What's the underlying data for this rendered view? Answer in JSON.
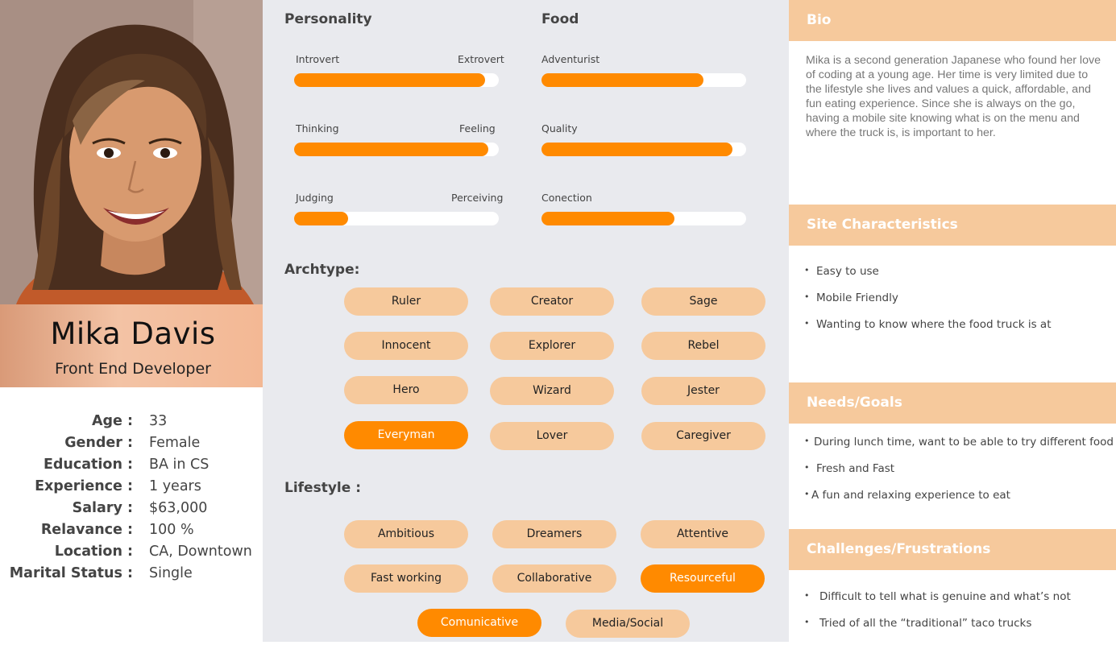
{
  "persona": {
    "name": "Mika Davis",
    "role": "Front End Developer",
    "facts": [
      {
        "key": "Age :",
        "value": "33"
      },
      {
        "key": "Gender :",
        "value": "Female"
      },
      {
        "key": "Education :",
        "value": "BA in CS"
      },
      {
        "key": "Experience :",
        "value": "1 years"
      },
      {
        "key": "Salary :",
        "value": "$63,000"
      },
      {
        "key": "Relavance :",
        "value": "100 %"
      },
      {
        "key": "Location :",
        "value": "CA, Downtown"
      },
      {
        "key": "Marital Status :",
        "value": "Single"
      }
    ]
  },
  "personality": {
    "title": "Personality",
    "scales": [
      {
        "left": "Introvert",
        "right": "Extrovert",
        "value": 0.935
      },
      {
        "left": "Thinking",
        "right": "Feeling",
        "value": 0.95
      },
      {
        "left": "Judging",
        "right": "Perceiving",
        "value": 0.265
      }
    ]
  },
  "food": {
    "title": "Food",
    "scales": [
      {
        "label": "Adventurist",
        "value": 0.79
      },
      {
        "label": "Quality",
        "value": 0.935
      },
      {
        "label": "Conection",
        "value": 0.65
      }
    ]
  },
  "archetype": {
    "title": "Archtype:",
    "items": [
      {
        "label": "Ruler",
        "active": false
      },
      {
        "label": "Creator",
        "active": false
      },
      {
        "label": "Sage",
        "active": false
      },
      {
        "label": "Innocent",
        "active": false
      },
      {
        "label": "Explorer",
        "active": false
      },
      {
        "label": "Rebel",
        "active": false
      },
      {
        "label": "Hero",
        "active": false
      },
      {
        "label": "Wizard",
        "active": false
      },
      {
        "label": "Jester",
        "active": false
      },
      {
        "label": "Everyman",
        "active": true
      },
      {
        "label": "Lover",
        "active": false
      },
      {
        "label": "Caregiver",
        "active": false
      }
    ]
  },
  "lifestyle": {
    "title": "Lifestyle :",
    "items": [
      {
        "label": "Ambitious",
        "active": false
      },
      {
        "label": "Dreamers",
        "active": false
      },
      {
        "label": "Attentive",
        "active": false
      },
      {
        "label": "Fast working",
        "active": false
      },
      {
        "label": "Collaborative",
        "active": false
      },
      {
        "label": "Resourceful",
        "active": true
      },
      {
        "label": "Comunicative",
        "active": true
      },
      {
        "label": "Media/Social",
        "active": false
      }
    ]
  },
  "bio": {
    "title": "Bio",
    "text": "Mika is a second generation Japanese who found her love of coding at a young age. Her time is very limited due to the lifestyle she lives and values a quick, affordable, and fun eating experience. Since she is always on the go, having a mobile site knowing what is on the menu and where the truck is, is important to her."
  },
  "site_characteristics": {
    "title": "Site Characteristics",
    "items": [
      "Easy to use",
      "Mobile Friendly",
      "Wanting to know where the food truck is at"
    ]
  },
  "needs_goals": {
    "title": "Needs/Goals",
    "items": [
      "During lunch time, want to be able to try different food at",
      "Fresh and Fast",
      "A fun and relaxing experience to eat"
    ]
  },
  "challenges": {
    "title": "Challenges/Frustrations",
    "items": [
      "Difficult to tell what is genuine and what’s not",
      "Tried of all the “traditional” taco trucks"
    ]
  },
  "colors": {
    "accent": "#ff8a00",
    "pill": "#f6c99c",
    "panel": "#e9eaee"
  }
}
